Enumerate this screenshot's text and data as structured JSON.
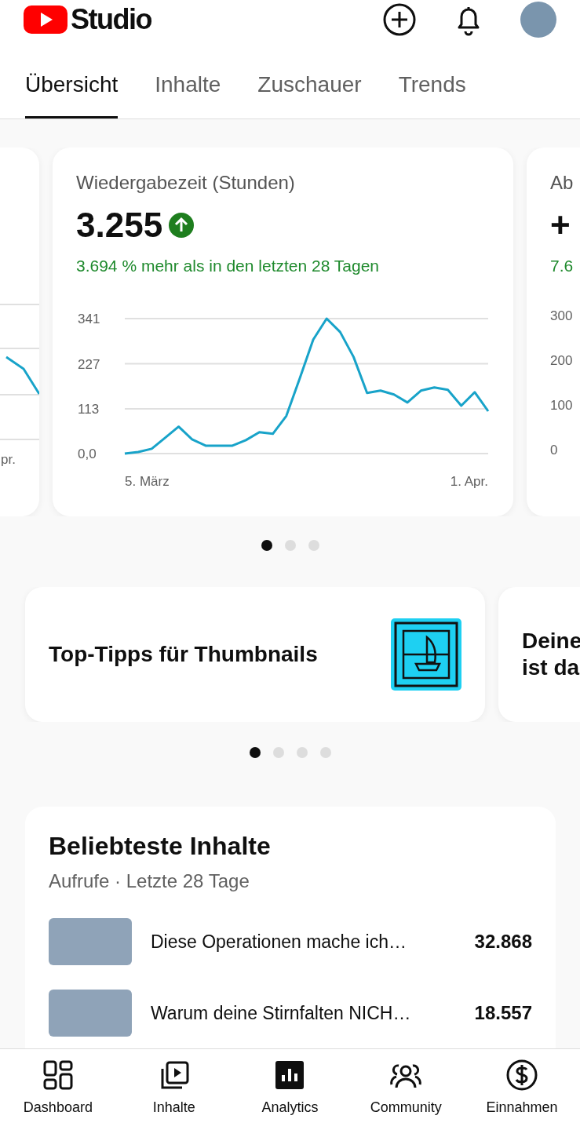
{
  "header": {
    "logo_text": "Studio"
  },
  "tabs": [
    {
      "label": "Übersicht",
      "selected": true
    },
    {
      "label": "Inhalte",
      "selected": false
    },
    {
      "label": "Zuschauer",
      "selected": false
    },
    {
      "label": "Trends",
      "selected": false
    }
  ],
  "metric_cards": [
    {
      "kind": "partial_left",
      "x_label": "pr."
    },
    {
      "kind": "full",
      "title": "Wiedergabezeit (Stunden)",
      "value": "3.255",
      "change": "3.694 % mehr als in den letzten 28 Tagen",
      "x_axis_labels": [
        "5. März",
        "1. Apr."
      ],
      "chart_data": {
        "type": "line",
        "series": [
          {
            "color": "#18a3c9",
            "values": [
              0,
              4,
              12,
              40,
              68,
              36,
              20,
              20,
              20,
              34,
              54,
              50,
              95,
              190,
              288,
              341,
              307,
              244,
              153,
              159,
              149,
              129,
              159,
              167,
              161,
              121,
              155,
              107
            ]
          }
        ],
        "ylim": [
          0,
          341
        ],
        "yticks": [
          {
            "value": 0,
            "label": "0,0"
          },
          113,
          227,
          341
        ]
      }
    },
    {
      "kind": "partial_right",
      "title": "Ab",
      "value": "+",
      "change": "7.6",
      "y_labels": [
        "300",
        "200",
        "100",
        "0"
      ]
    }
  ],
  "metric_dots": [
    {
      "selected": true
    },
    {
      "selected": false
    },
    {
      "selected": false
    }
  ],
  "tips": [
    {
      "kind": "full",
      "title": "Top-Tipps für Thumbnails"
    },
    {
      "kind": "partial",
      "lines": [
        "Deine",
        "ist da"
      ]
    }
  ],
  "tip_dots": [
    {
      "selected": true
    },
    {
      "selected": false
    },
    {
      "selected": false
    },
    {
      "selected": false
    }
  ],
  "top_content": {
    "title": "Beliebteste Inhalte",
    "subtitle": "Aufrufe · Letzte 28 Tage",
    "rows": [
      {
        "title": "Diese Operationen mache ich…",
        "views": "32.868"
      },
      {
        "title": "Warum deine Stirnfalten NICH…",
        "views": "18.557"
      }
    ]
  },
  "bottom_nav": [
    {
      "label": "Dashboard",
      "selected": false
    },
    {
      "label": "Inhalte",
      "selected": false
    },
    {
      "label": "Analytics",
      "selected": true
    },
    {
      "label": "Community",
      "selected": false
    },
    {
      "label": "Einnahmen",
      "selected": false
    }
  ]
}
